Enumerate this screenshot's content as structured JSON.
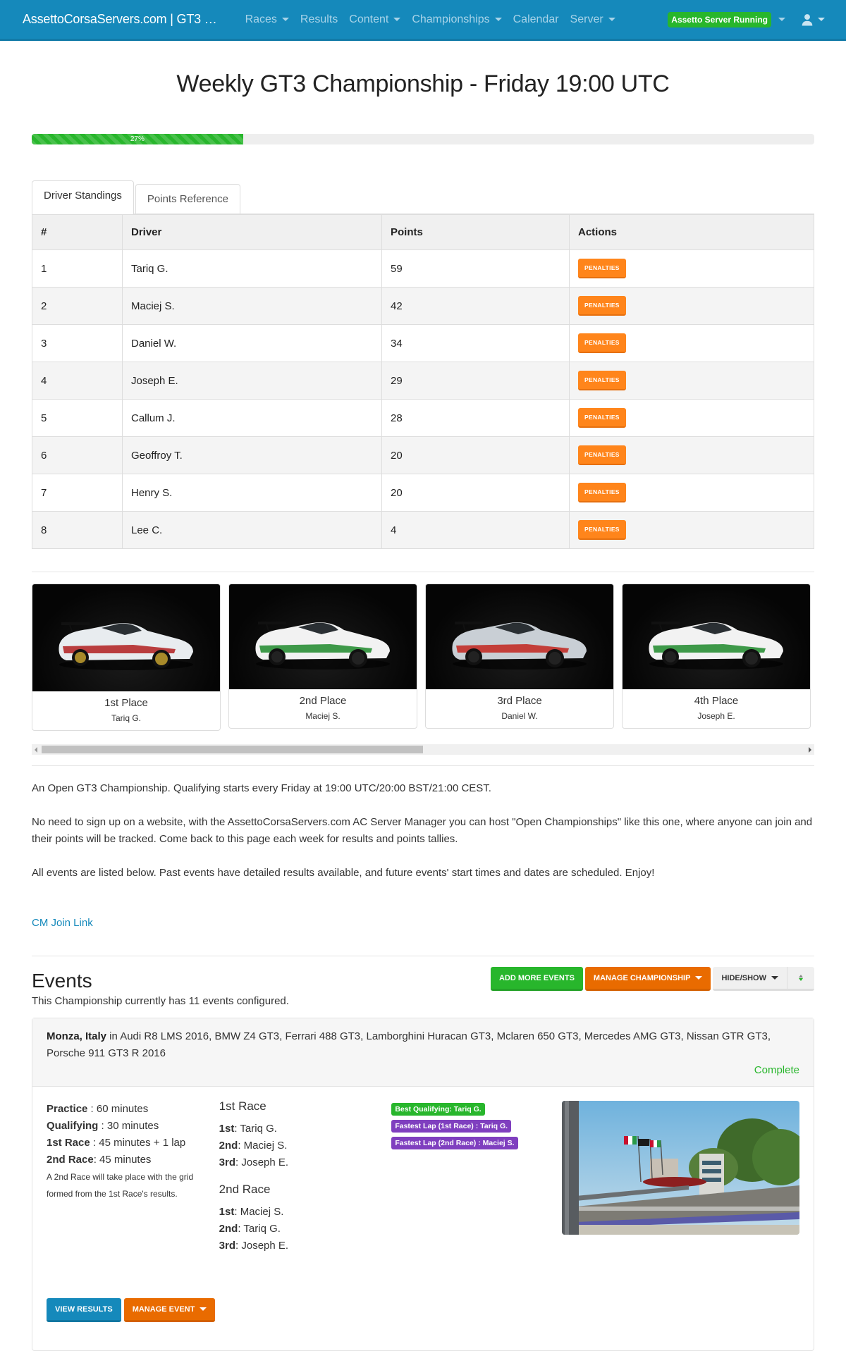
{
  "navbar": {
    "brand": "AssettoCorsaServers.com | GT3 …",
    "items": [
      {
        "label": "Races",
        "dropdown": true
      },
      {
        "label": "Results",
        "dropdown": false
      },
      {
        "label": "Content",
        "dropdown": true
      },
      {
        "label": "Championships",
        "dropdown": true
      },
      {
        "label": "Calendar",
        "dropdown": false
      },
      {
        "label": "Server",
        "dropdown": true
      }
    ],
    "server_status": "Assetto Server Running",
    "user_icon": "user-icon"
  },
  "page": {
    "title": "Weekly GT3 Championship - Friday 19:00 UTC",
    "progress_percent": 27,
    "progress_label": "27%"
  },
  "tabs": [
    {
      "label": "Driver Standings",
      "active": true
    },
    {
      "label": "Points Reference",
      "active": false
    }
  ],
  "standings": {
    "columns": [
      "#",
      "Driver",
      "Points",
      "Actions"
    ],
    "action_label": "PENALTIES",
    "rows": [
      {
        "pos": "1",
        "driver": "Tariq G.",
        "points": "59"
      },
      {
        "pos": "2",
        "driver": "Maciej S.",
        "points": "42"
      },
      {
        "pos": "3",
        "driver": "Daniel W.",
        "points": "34"
      },
      {
        "pos": "4",
        "driver": "Joseph E.",
        "points": "29"
      },
      {
        "pos": "5",
        "driver": "Callum J.",
        "points": "28"
      },
      {
        "pos": "6",
        "driver": "Geoffroy T.",
        "points": "20"
      },
      {
        "pos": "7",
        "driver": "Henry S.",
        "points": "20"
      },
      {
        "pos": "8",
        "driver": "Lee C.",
        "points": "4"
      }
    ]
  },
  "podium": [
    {
      "place": "1st Place",
      "driver": "Tariq G.",
      "body": "#e8ecef",
      "accent": "#b01e1e",
      "wheel": "#a88a2a"
    },
    {
      "place": "2nd Place",
      "driver": "Maciej S.",
      "body": "#f2f2f2",
      "accent": "#1f8a2b",
      "wheel": "#222222"
    },
    {
      "place": "3rd Place",
      "driver": "Daniel W.",
      "body": "#c9cfd5",
      "accent": "#c2241d",
      "wheel": "#222222"
    },
    {
      "place": "4th Place",
      "driver": "Joseph E.",
      "body": "#f2f2f2",
      "accent": "#1f8a2b",
      "wheel": "#222222"
    }
  ],
  "description": {
    "paragraphs": [
      "An Open GT3 Championship. Qualifying starts every Friday at 19:00 UTC/20:00 BST/21:00 CEST.",
      "No need to sign up on a website, with the AssettoCorsaServers.com AC Server Manager you can host \"Open Championships\" like this one, where anyone can join and their points will be tracked. Come back to this page each week for results and points tallies.",
      "All events are listed below. Past events have detailed results available, and future events' start times and dates are scheduled. Enjoy!"
    ],
    "join_link": "CM Join Link"
  },
  "events": {
    "title": "Events",
    "count_text": "This Championship currently has 11 events configured.",
    "buttons": {
      "add": "ADD MORE EVENTS",
      "manage": "MANAGE CHAMPIONSHIP",
      "hide_show": "HIDE/SHOW"
    },
    "list": [
      {
        "track": "Monza, Italy",
        "cars_text": " in Audi R8 LMS 2016, BMW Z4 GT3, Ferrari 488 GT3, Lamborghini Huracan GT3, Mclaren 650 GT3, Mercedes AMG GT3, Nissan GTR GT3, Porsche 911 GT3 R 2016",
        "status": "Complete",
        "sessions": [
          {
            "name": "Practice",
            "sep": " : ",
            "value": "60 minutes"
          },
          {
            "name": "Qualifying",
            "sep": " : ",
            "value": "30 minutes"
          },
          {
            "name": "1st Race",
            "sep": " : ",
            "value": "45 minutes + 1 lap"
          },
          {
            "name": "2nd Race",
            "sep": ": ",
            "value": "45 minutes"
          }
        ],
        "note": "A 2nd Race will take place with the grid formed from the 1st Race's results.",
        "race1": {
          "title": "1st Race",
          "results": [
            {
              "pos": "1st",
              "driver": ": Tariq G."
            },
            {
              "pos": "2nd",
              "driver": ": Maciej S."
            },
            {
              "pos": "3rd",
              "driver": ": Joseph E."
            }
          ]
        },
        "race2": {
          "title": "2nd Race",
          "results": [
            {
              "pos": "1st",
              "driver": ": Maciej S."
            },
            {
              "pos": "2nd",
              "driver": ": Tariq G."
            },
            {
              "pos": "3rd",
              "driver": ": Joseph E."
            }
          ]
        },
        "awards": [
          {
            "label": "Best Qualifying: Tariq G.",
            "color": "green"
          },
          {
            "label": "Fastest Lap (1st Race) : Tariq G.",
            "color": "purple"
          },
          {
            "label": "Fastest Lap (2nd Race) : Maciej S.",
            "color": "purple"
          }
        ],
        "view_results": "VIEW RESULTS",
        "manage_event": "MANAGE EVENT"
      }
    ]
  },
  "colors": {
    "primary": "#1589bb",
    "success": "#28b62c",
    "warning": "#ff851b",
    "orange": "#e96b00",
    "purple": "#7f3fbf"
  }
}
